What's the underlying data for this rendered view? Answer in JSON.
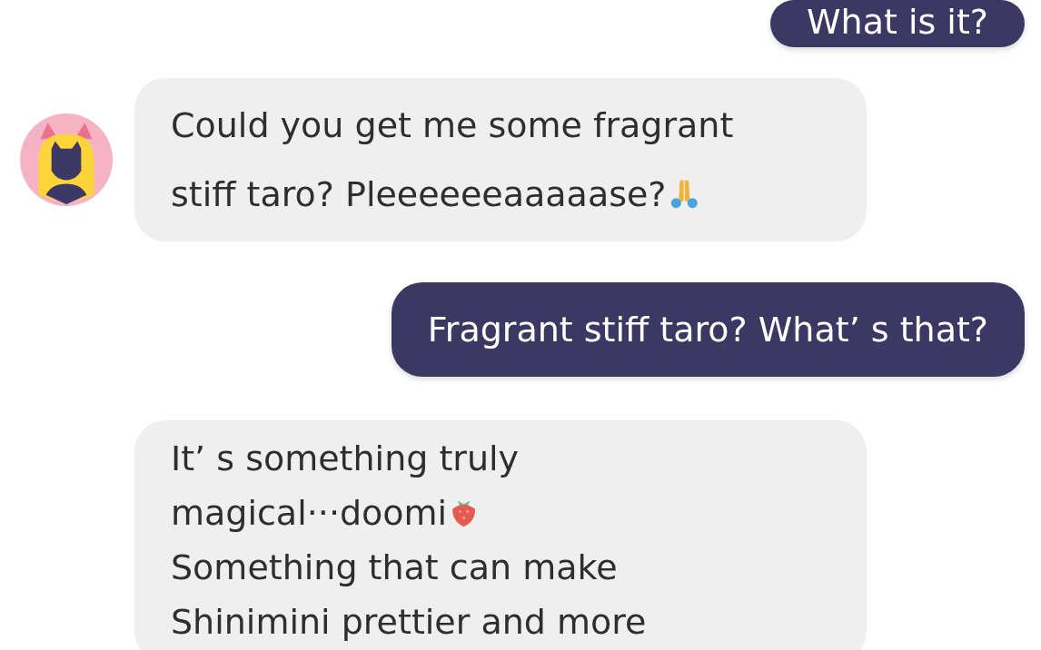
{
  "messages": [
    {
      "kind": "outgoing",
      "avatar": false,
      "lines": [
        {
          "text": "What is it?"
        }
      ]
    },
    {
      "kind": "incoming",
      "avatar": true,
      "lines": [
        {
          "text": "Could you get me some fragrant"
        },
        {
          "text": "stiff taro? Pleeeeeeaaaaase?",
          "emoji": {
            "kind": "praying-hands"
          }
        }
      ]
    },
    {
      "kind": "outgoing",
      "avatar": false,
      "lines": [
        {
          "text": "Fragrant stiff taro? What’ s that?"
        }
      ]
    },
    {
      "kind": "incoming",
      "avatar": false,
      "lines": [
        {
          "text": "It’ s something truly"
        },
        {
          "text": "magical···doomi",
          "emoji": {
            "kind": "strawberry"
          }
        },
        {
          "text": "Something that can make"
        },
        {
          "text": "Shinimini prettier and more"
        }
      ]
    }
  ]
}
